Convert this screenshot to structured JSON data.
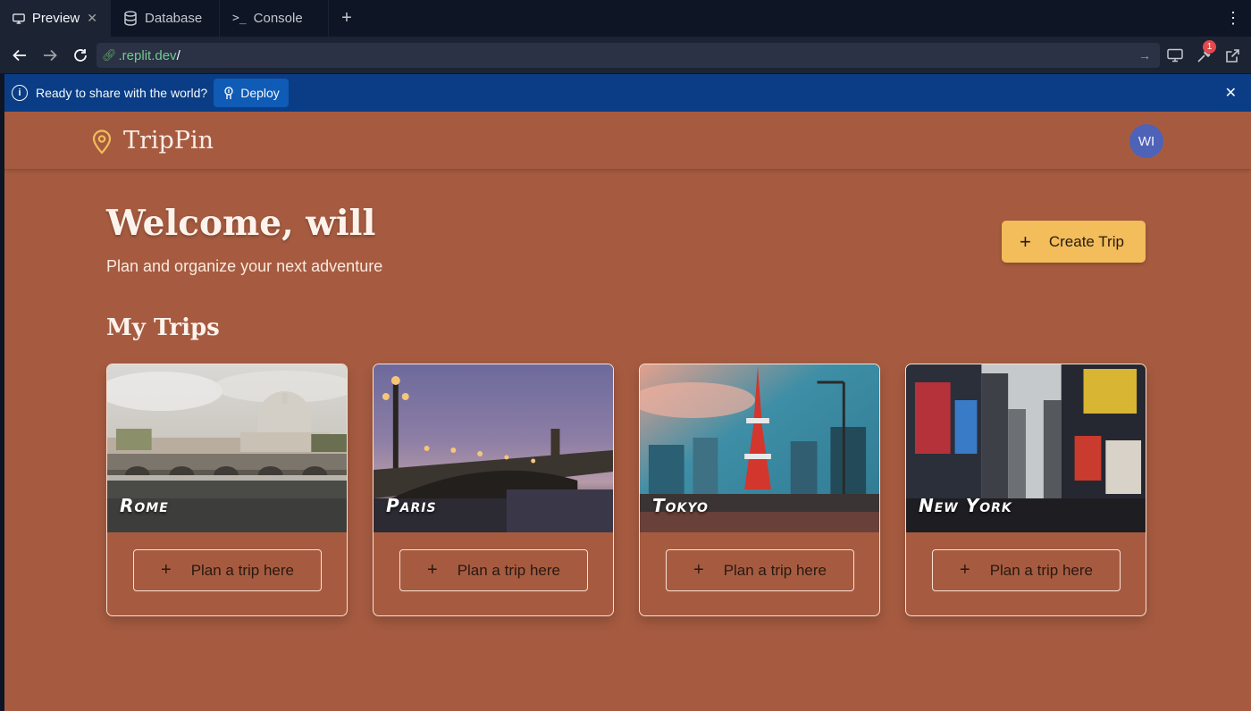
{
  "browser": {
    "tabs": [
      {
        "label": "Preview",
        "icon": "monitor-icon"
      },
      {
        "label": "Database",
        "icon": "database-icon"
      },
      {
        "label": "Console",
        "icon": "terminal-icon"
      }
    ],
    "url": {
      "host": ".replit.dev",
      "path": "/"
    },
    "notification_count": "1"
  },
  "banner": {
    "message": "Ready to share with the world?",
    "deploy_label": "Deploy"
  },
  "app": {
    "logo": "TripPin",
    "avatar_initials": "WI",
    "welcome": "Welcome, will",
    "subtitle": "Plan and organize your next adventure",
    "create_trip_label": "Create Trip",
    "section_title": "My Trips",
    "trips": [
      {
        "city": "Rome",
        "action": "Plan a trip here"
      },
      {
        "city": "Paris",
        "action": "Plan a trip here"
      },
      {
        "city": "Tokyo",
        "action": "Plan a trip here"
      },
      {
        "city": "New York",
        "action": "Plan a trip here"
      }
    ]
  },
  "colors": {
    "accent": "#f2bd5a",
    "background": "#a65b40",
    "banner": "#0a3d85",
    "avatar": "#4e62b8"
  }
}
